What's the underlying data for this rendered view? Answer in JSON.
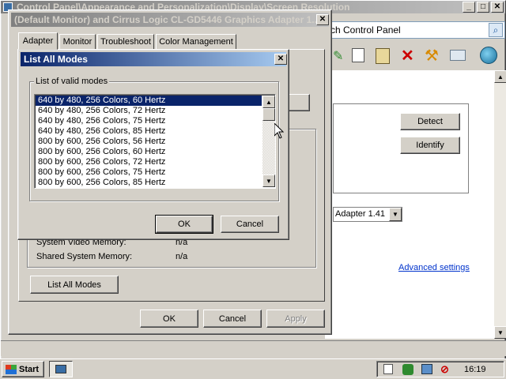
{
  "explorer": {
    "address_title": "Control Panel\\Appearance and Personalization\\Display\\Screen Resolution",
    "search_placeholder": "rch Control Panel",
    "detect_label": "Detect",
    "identify_label": "Identify",
    "adapter_select_value": "Adapter 1.41",
    "advanced_settings_link": "Advanced settings"
  },
  "props_dialog": {
    "title": "(Default Monitor) and Cirrus Logic CL-GD5446 Graphics Adapter 1....",
    "tabs": [
      "Adapter",
      "Monitor",
      "Troubleshoot",
      "Color Management"
    ],
    "system_video_memory_label": "System Video Memory:",
    "system_video_memory_value": "n/a",
    "shared_memory_label": "Shared System Memory:",
    "shared_memory_value": "n/a",
    "list_all_modes_button": "List All Modes",
    "ok_label": "OK",
    "cancel_label": "Cancel",
    "apply_label": "Apply"
  },
  "modes_dialog": {
    "title": "List All Modes",
    "group_label": "List of valid modes",
    "modes": [
      "640 by 480, 256 Colors, 60 Hertz",
      "640 by 480, 256 Colors, 72 Hertz",
      "640 by 480, 256 Colors, 75 Hertz",
      "640 by 480, 256 Colors, 85 Hertz",
      "800 by 600, 256 Colors, 56 Hertz",
      "800 by 600, 256 Colors, 60 Hertz",
      "800 by 600, 256 Colors, 72 Hertz",
      "800 by 600, 256 Colors, 75 Hertz",
      "800 by 600, 256 Colors, 85 Hertz"
    ],
    "selected_index": 0,
    "ok_label": "OK",
    "cancel_label": "Cancel"
  },
  "taskbar": {
    "start_label": "Start",
    "clock": "16:19"
  },
  "colors": {
    "title_active": "#0a246a",
    "face": "#d4d0c8",
    "taskbar": "#d4d0c8"
  }
}
